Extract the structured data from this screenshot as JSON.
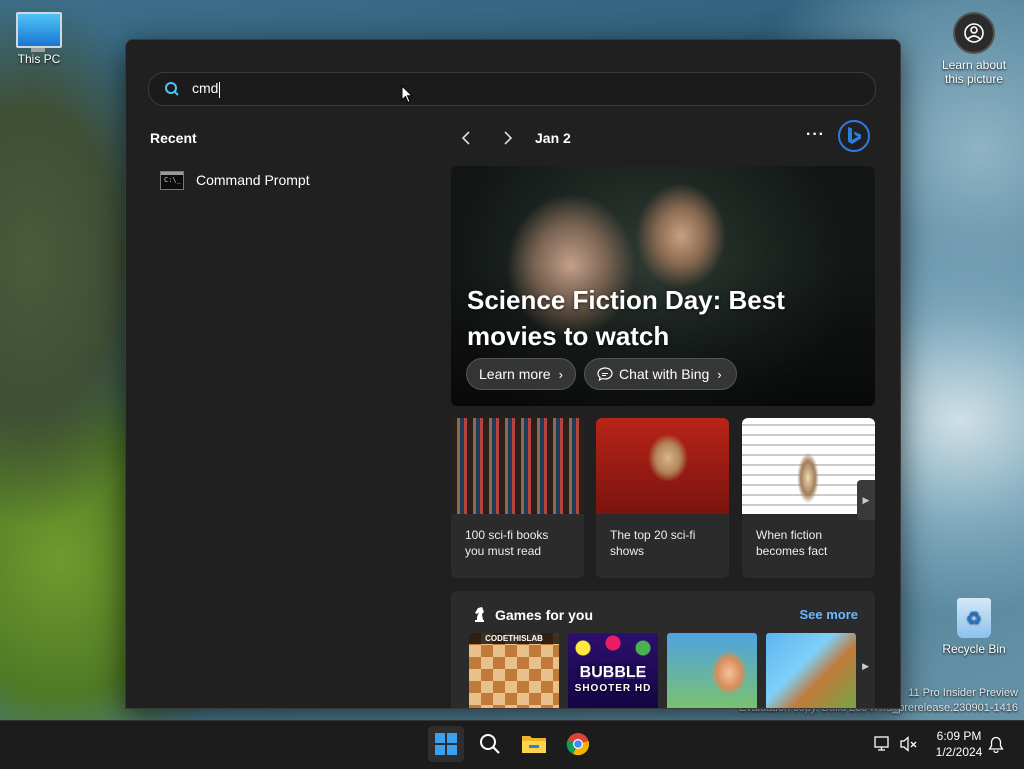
{
  "desktop": {
    "this_pc_label": "This PC",
    "learn_label": "Learn about this picture",
    "recycle_label": "Recycle Bin",
    "watermark_line1": "11 Pro Insider Preview",
    "watermark_line2": "Evaluation copy. Build 23547.rs_prerelease.230901-1416"
  },
  "search": {
    "query": "cmd",
    "recent_heading": "Recent",
    "recent_items": [
      {
        "label": "Command Prompt",
        "icon": "cmd-icon"
      }
    ]
  },
  "highlights": {
    "date": "Jan 2",
    "hero": {
      "title": "Science Fiction Day: Best movies to watch",
      "learn_more": "Learn more",
      "chat_bing": "Chat with Bing"
    },
    "cards": [
      {
        "caption": "100 sci-fi books you must read"
      },
      {
        "caption": "The top 20 sci-fi shows"
      },
      {
        "caption": "When fiction becomes fact"
      }
    ],
    "games": {
      "heading": "Games for you",
      "see_more": "See more",
      "tiles": [
        {
          "tag": "CODETHISLAB",
          "word": "",
          "word2": ""
        },
        {
          "tag": "",
          "word": "BUBBLE",
          "word2": "SHOOTER HD"
        },
        {
          "tag": "",
          "word": "",
          "word2": ""
        },
        {
          "tag": "",
          "word": "",
          "word2": ""
        }
      ]
    }
  },
  "taskbar": {
    "time": "6:09 PM",
    "date": "1/2/2024"
  },
  "colors": {
    "accent": "#2d7ce0",
    "link": "#6cb8ff",
    "panel_bg": "#202020"
  }
}
